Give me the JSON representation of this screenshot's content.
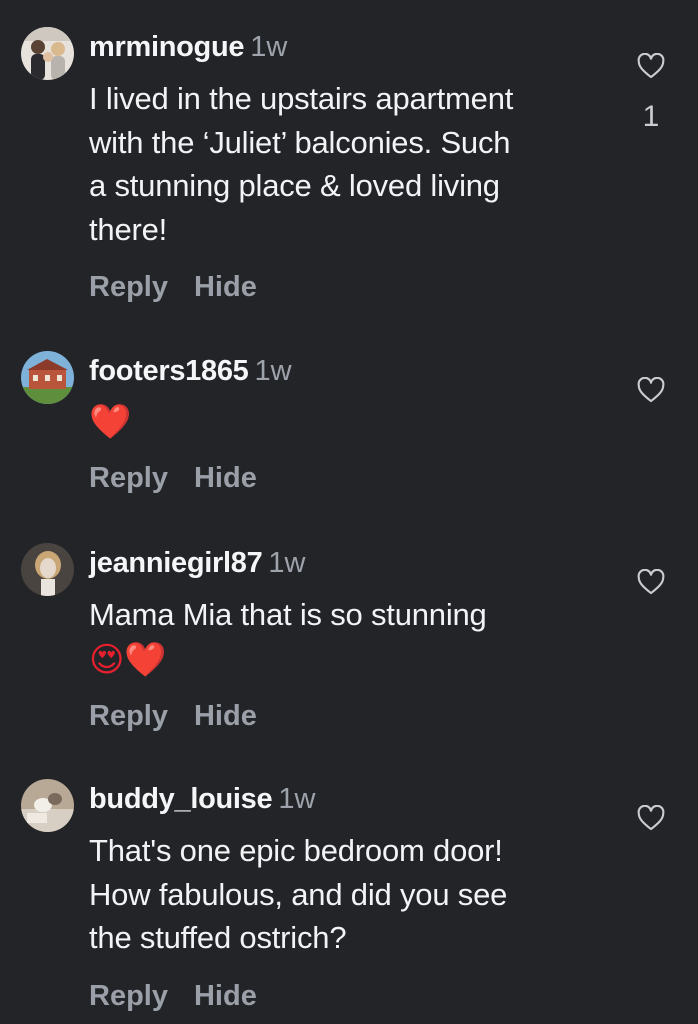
{
  "comments": [
    {
      "username": "mrminogue",
      "time": "1w",
      "text_lines": [
        "I lived in the upstairs apartment",
        "with the ‘Juliet’ balconies. Such",
        "a stunning place & loved living",
        "there!"
      ],
      "reply_label": "Reply",
      "hide_label": "Hide",
      "like_count": "1"
    },
    {
      "username": "footers1865",
      "time": "1w",
      "emoji": "❤️",
      "reply_label": "Reply",
      "hide_label": "Hide"
    },
    {
      "username": "jeanniegirl87",
      "time": "1w",
      "text_lines": [
        "Mama Mia that is so stunning"
      ],
      "emoji": "😍❤️",
      "reply_label": "Reply",
      "hide_label": "Hide"
    },
    {
      "username": "buddy_louise",
      "time": "1w",
      "text_lines": [
        "That's one epic bedroom door!",
        "How fabulous, and did you see",
        "the stuffed ostrich?"
      ],
      "reply_label": "Reply",
      "hide_label": "Hide"
    }
  ],
  "icons": {
    "like": "heart-outline-icon"
  },
  "colors": {
    "background": "#222428",
    "text": "#f2f3f5",
    "muted": "#9ba0a8",
    "heart_emoji": "#e8202e"
  }
}
